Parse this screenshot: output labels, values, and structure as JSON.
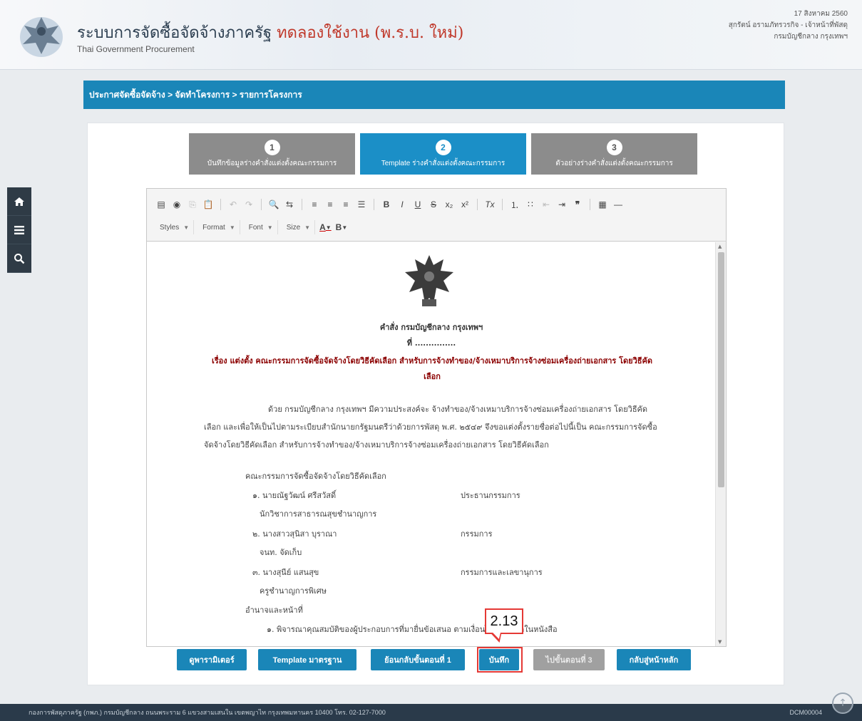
{
  "header": {
    "title_main": "ระบบการจัดซื้อจัดจ้างภาครัฐ",
    "title_trial": "ทดลองใช้งาน (พ.ร.บ. ใหม่)",
    "subtitle": "Thai Government Procurement",
    "user_date": "17 สิงหาคม 2560",
    "user_name": "สุกรัตน์ อรามภัทรวรกิจ - เจ้าหน้าที่พัสดุ",
    "user_org": "กรมบัญชีกลาง กรุงเทพฯ"
  },
  "sidebar": {
    "items": [
      "home-icon",
      "menu-icon",
      "search-icon"
    ]
  },
  "breadcrumb": "ประกาศจัดซื้อจัดจ้าง > จัดทำโครงการ > รายการโครงการ",
  "steps": [
    {
      "num": "1",
      "label": "บันทึกข้อมูลร่างคำสั่งแต่งตั้งคณะกรรมการ"
    },
    {
      "num": "2",
      "label": "Template ร่างคำสั่งแต่งตั้งคณะกรรมการ"
    },
    {
      "num": "3",
      "label": "ตัวอย่างร่างคำสั่งแต่งตั้งคณะกรรมการ"
    }
  ],
  "toolbar": {
    "row1": [
      "Source",
      "Save",
      "Copy",
      "Paste",
      "Undo",
      "Redo",
      "Find",
      "Replace",
      "Align left",
      "Align center",
      "Align right",
      "Justify",
      "B",
      "I",
      "U",
      "S",
      "x₂",
      "x²",
      "Tx",
      "Numbered list",
      "Bullet list",
      "Outdent",
      "Indent",
      "Quote",
      "Table",
      "Horizontal line"
    ],
    "combos": [
      "Styles",
      "Format",
      "Font",
      "Size"
    ],
    "color_text": "A",
    "color_bg": "B"
  },
  "document": {
    "title": "คำสั่ง กรมบัญชีกลาง กรุงเทพฯ",
    "number": "ที่ ...............",
    "subject": "เรื่อง แต่งตั้ง คณะกรรมการจัดซื้อจัดจ้างโดยวิธีคัดเลือก สำหรับการจ้างทำของ/จ้างเหมาบริการจ้างซ่อมเครื่องถ่ายเอกสาร โดยวิธีคัดเลือก",
    "paragraph": "ด้วย กรมบัญชีกลาง กรุงเทพฯ มีความประสงค์จะ จ้างทำของ/จ้างเหมาบริการจ้างซ่อมเครื่องถ่ายเอกสาร โดยวิธีคัดเลือก และเพื่อให้เป็นไปตามระเบียบสำนักนายกรัฐมนตรีว่าด้วยการพัสดุ พ.ศ. ๒๕๔๙ จึงขอแต่งตั้งรายชื่อต่อไปนี้เป็น คณะกรรมการจัดซื้อจัดจ้างโดยวิธีคัดเลือก สำหรับการจ้างทำของ/จ้างเหมาบริการจ้างซ่อมเครื่องถ่ายเอกสาร โดยวิธีคัดเลือก",
    "committee_heading": "คณะกรรมการจัดซื้อจัดจ้างโดยวิธีคัดเลือก",
    "members": [
      {
        "name": "๑. นายณัฐวัฒน์ ศรีสวัสดิ์",
        "role": "ประธานกรรมการ",
        "position": "นักวิชาการสาธารณสุขชำนาญการ"
      },
      {
        "name": "๒. นางสาวสุนิสา บุราณา",
        "role": "กรรมการ",
        "position": "จนท. จัดเก็บ"
      },
      {
        "name": "๓. นางสุนีย์ แสนสุข",
        "role": "กรรมการและเลขานุการ",
        "position": "ครูชำนาญการพิเศษ"
      }
    ],
    "duty_heading": "อำนาจและหน้าที่",
    "duty_first": "๑. พิจารณาคุณสมบัติของผู้ประกอบการที่มายื่นข้อเสนอ ตามเงื่อนไขที่กำหนดในหนังสือ"
  },
  "buttons": {
    "print": "ดูพารามิเตอร์",
    "template_std": "Template มาตรฐาน",
    "back_step1": "ย้อนกลับขั้นตอนที่ 1",
    "save": "บันทึก",
    "next_step3": "ไปขั้นตอนที่ 3",
    "home": "กลับสู่หน้าหลัก"
  },
  "annotation": {
    "label": "2.13",
    "color": "#e53935"
  },
  "footer": {
    "text": "กองการพัสดุภาครัฐ (กพภ.) กรมบัญชีกลาง ถนนพระราม 6 แขวงสามเสนใน เขตพญาไท กรุงเทพมหานคร 10400 โทร. 02-127-7000",
    "code": "DCM00004"
  },
  "colors": {
    "primary": "#1a86b8",
    "active_step": "#1b8fc7",
    "inactive_step": "#8c8c8c",
    "footer": "#2a3a4a"
  }
}
